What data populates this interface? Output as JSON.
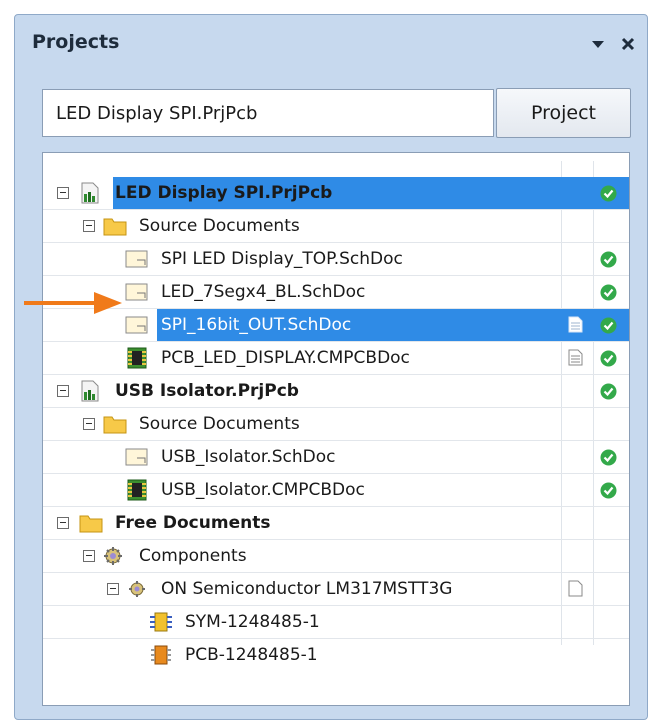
{
  "panel": {
    "title": "Projects",
    "menu_icon": "dropdown-arrow-icon",
    "close_icon": "close-icon"
  },
  "project_selector": {
    "value": "LED Display SPI.PrjPcb",
    "button_label": "Project"
  },
  "tree": {
    "rows": [
      {
        "label": "LED Display SPI.PrjPcb",
        "type": "project",
        "status": "ok",
        "selected": true
      },
      {
        "label": "Source Documents",
        "type": "folder"
      },
      {
        "label": "SPI LED Display_TOP.SchDoc",
        "type": "schdoc",
        "status": "ok"
      },
      {
        "label": "LED_7Segx4_BL.SchDoc",
        "type": "schdoc",
        "status": "ok"
      },
      {
        "label": "SPI_16bit_OUT.SchDoc",
        "type": "schdoc",
        "status": "ok",
        "selected": true,
        "modified": true
      },
      {
        "label": "PCB_LED_DISPLAY.CMPCBDoc",
        "type": "pcbdoc",
        "status": "ok",
        "modified": true
      },
      {
        "label": "USB Isolator.PrjPcb",
        "type": "project",
        "status": "ok"
      },
      {
        "label": "Source Documents",
        "type": "folder"
      },
      {
        "label": "USB_Isolator.SchDoc",
        "type": "schdoc",
        "status": "ok"
      },
      {
        "label": "USB_Isolator.CMPCBDoc",
        "type": "pcbdoc",
        "status": "ok"
      },
      {
        "label": "Free Documents",
        "type": "folder"
      },
      {
        "label": "Components",
        "type": "components"
      },
      {
        "label": "ON Semiconductor LM317MSTT3G",
        "type": "component",
        "modified": true
      },
      {
        "label": "SYM-1248485-1",
        "type": "symbol"
      },
      {
        "label": "PCB-1248485-1",
        "type": "footprint"
      }
    ]
  },
  "colors": {
    "selection": "#2f8be6",
    "status_ok": "#33a94a",
    "arrow": "#f07a1a",
    "panel_bg": "#c7d9ee"
  }
}
